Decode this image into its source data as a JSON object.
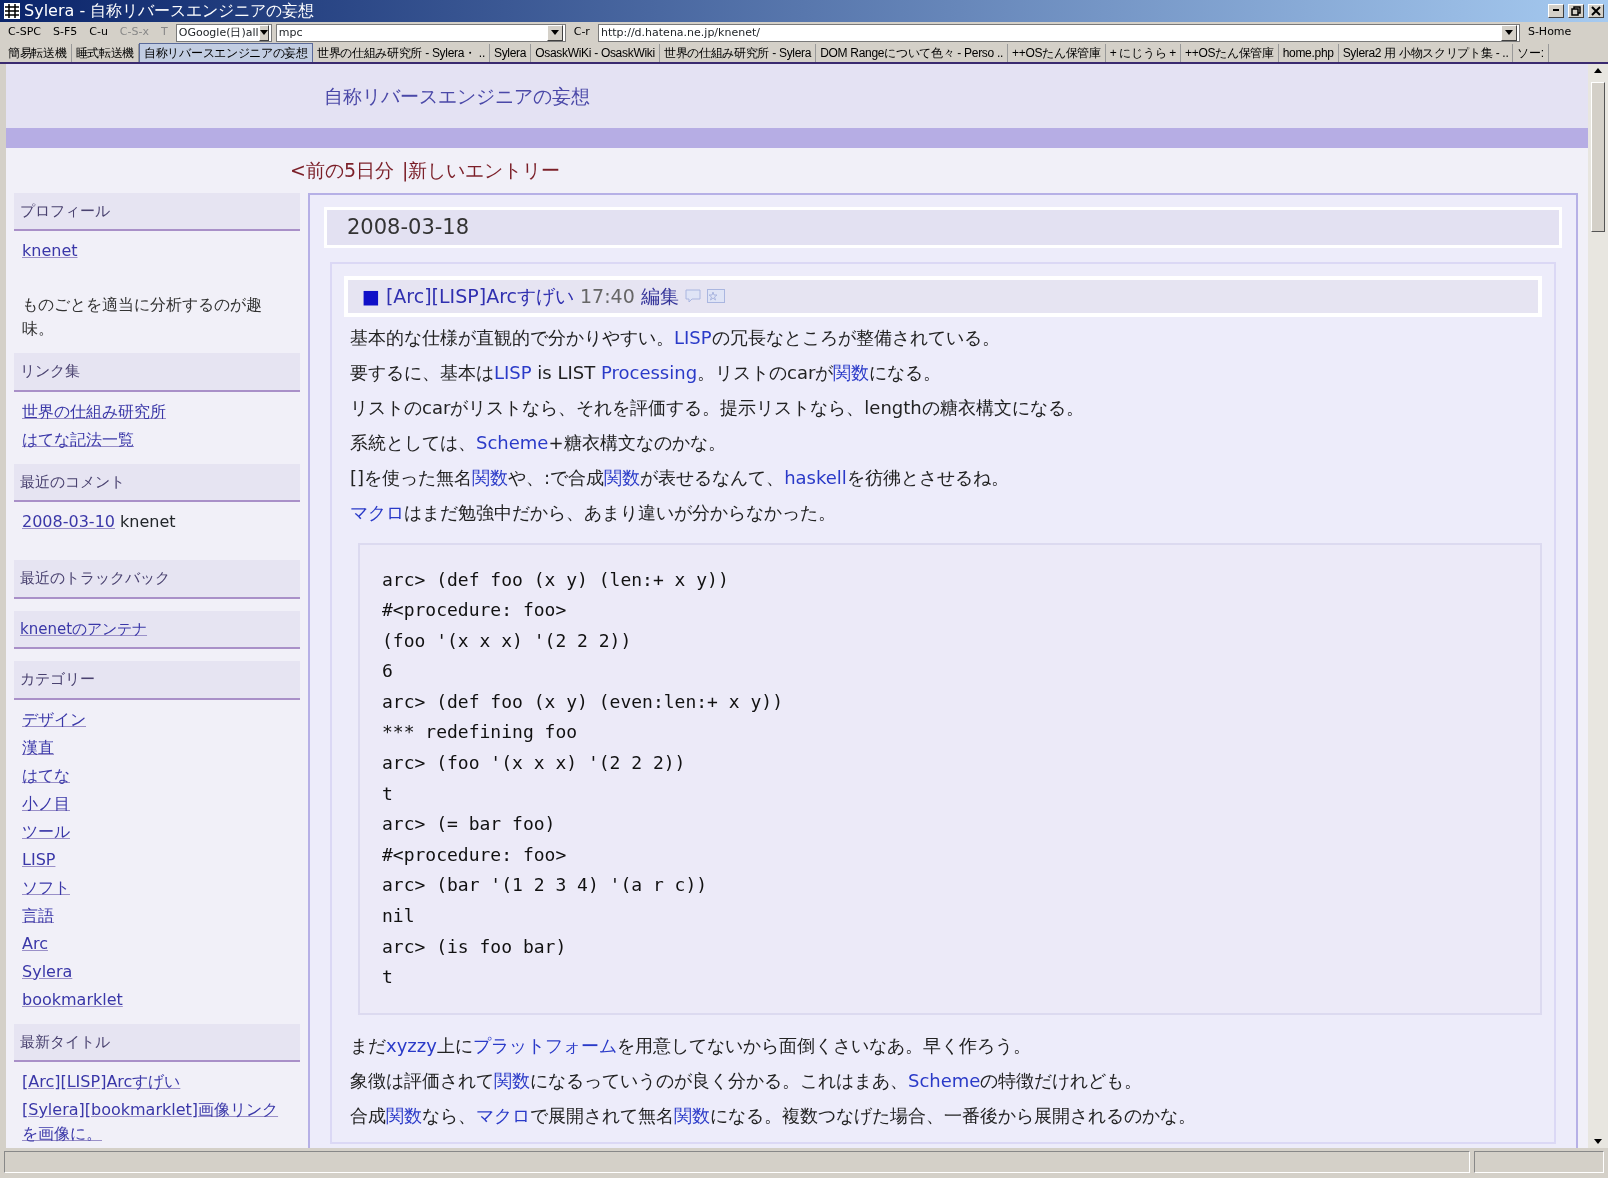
{
  "window": {
    "title": "Sylera - 自称リバースエンジニアの妄想"
  },
  "toolbar": {
    "keys": [
      {
        "label": "C-SPC",
        "disabled": false
      },
      {
        "label": "S-F5",
        "disabled": false
      },
      {
        "label": "C-u",
        "disabled": false
      },
      {
        "label": "C-S-x",
        "disabled": true
      },
      {
        "label": "T",
        "disabled": true
      }
    ],
    "engine": "OGoogle(日)all",
    "search_value": "mpc",
    "url_key": "C-r",
    "url": "http://d.hatena.ne.jp/knenet/",
    "home_key": "S-Home"
  },
  "bookmarks": [
    {
      "label": "簡易転送機",
      "selected": false
    },
    {
      "label": "睡式転送機",
      "selected": false
    },
    {
      "label": "自称リバースエンジニアの妄想",
      "selected": true
    },
    {
      "label": "世界の仕組み研究所 - Sylera・ ..",
      "selected": false
    },
    {
      "label": "Sylera",
      "selected": false
    },
    {
      "label": "OsaskWiKi - OsaskWiki",
      "selected": false
    },
    {
      "label": "世界の仕組み研究所 - Sylera",
      "selected": false
    },
    {
      "label": "DOM Rangeについて色々 - Perso ..",
      "selected": false
    },
    {
      "label": "++OSたん保管庫",
      "selected": false
    },
    {
      "label": "+ にじうら +",
      "selected": false
    },
    {
      "label": "++OSたん保管庫",
      "selected": false
    },
    {
      "label": "home.php",
      "selected": false
    },
    {
      "label": "Sylera2 用 小物スクリプト集 - ..",
      "selected": false
    },
    {
      "label": "ソー:",
      "selected": false
    }
  ],
  "blog": {
    "title": "自称リバースエンジニアの妄想",
    "nav": [
      {
        "text": "<前の5日分"
      },
      {
        "text": "|新しいエントリー"
      }
    ]
  },
  "sidebar": [
    {
      "kind": "plain",
      "heading": "プロフィール",
      "items": [
        {
          "kind": "link",
          "text": "knenet"
        }
      ],
      "note": "ものごとを適当に分析するのが趣味。"
    },
    {
      "kind": "plain",
      "heading": "リンク集",
      "items": [
        {
          "kind": "link",
          "text": "世界の仕組み研究所"
        },
        {
          "kind": "link",
          "text": "はてな記法一覧"
        }
      ]
    },
    {
      "kind": "plain",
      "heading": "最近のコメント",
      "items": [
        {
          "kind": "link",
          "text": "2008-03-10",
          "after": "knenet"
        }
      ]
    },
    {
      "kind": "plain",
      "heading": "最近のトラックバック"
    },
    {
      "kind": "link",
      "heading": "knenetのアンテナ"
    },
    {
      "kind": "plain",
      "heading": "カテゴリー",
      "items": [
        {
          "kind": "link",
          "text": "デザイン"
        },
        {
          "kind": "link",
          "text": "漢直"
        },
        {
          "kind": "link",
          "text": "はてな"
        },
        {
          "kind": "link",
          "text": "小ノ目"
        },
        {
          "kind": "link",
          "text": "ツール"
        },
        {
          "kind": "link",
          "text": "LISP"
        },
        {
          "kind": "link",
          "text": "ソフト"
        },
        {
          "kind": "link",
          "text": "言語"
        },
        {
          "kind": "link",
          "text": "Arc"
        },
        {
          "kind": "link",
          "text": "Sylera"
        },
        {
          "kind": "link",
          "text": "bookmarklet"
        }
      ]
    },
    {
      "kind": "plain",
      "heading": "最新タイトル",
      "items": [
        {
          "kind": "link",
          "text": "[Arc][LISP]Arcすげい"
        },
        {
          "kind": "link",
          "text": "[Sylera][bookmarklet]画像リンクを画像に。"
        }
      ]
    }
  ],
  "entry": {
    "date": "2008-03-18",
    "section_mark": "■",
    "section_title": "[Arc][LISP]Arcすげい",
    "time": "17:40",
    "edit": "編集",
    "before": [
      [
        {
          "kind": "text",
          "text": "基本的な仕様が直観的で分かりやすい。"
        },
        {
          "kind": "link",
          "text": "LISP"
        },
        {
          "kind": "text",
          "text": "の冗長なところが整備されている。"
        }
      ],
      [
        {
          "kind": "text",
          "text": "要するに、基本は"
        },
        {
          "kind": "link",
          "text": "LISP"
        },
        {
          "kind": "text",
          "text": " is LIST "
        },
        {
          "kind": "link",
          "text": "Processing"
        },
        {
          "kind": "text",
          "text": "。リストのcarが"
        },
        {
          "kind": "link",
          "text": "関数"
        },
        {
          "kind": "text",
          "text": "になる。"
        }
      ],
      [
        {
          "kind": "text",
          "text": "リストのcarがリストなら、それを評価する。提示リストなら、lengthの糖衣構文になる。"
        }
      ],
      [
        {
          "kind": "text",
          "text": "系統としては、"
        },
        {
          "kind": "link",
          "text": "Scheme"
        },
        {
          "kind": "text",
          "text": "+糖衣構文なのかな。"
        }
      ],
      [
        {
          "kind": "text",
          "text": "[]を使った無名"
        },
        {
          "kind": "link",
          "text": "関数"
        },
        {
          "kind": "text",
          "text": "や、:で合成"
        },
        {
          "kind": "link",
          "text": "関数"
        },
        {
          "kind": "text",
          "text": "が表せるなんて、"
        },
        {
          "kind": "link",
          "text": "haskell"
        },
        {
          "kind": "text",
          "text": "を彷彿とさせるね。"
        }
      ],
      [
        {
          "kind": "link",
          "text": "マクロ"
        },
        {
          "kind": "text",
          "text": "はまだ勉強中だから、あまり違いが分からなかった。"
        }
      ]
    ],
    "code": [
      "arc> (def foo (x y) (len:+ x y))",
      "#<procedure: foo>",
      "(foo '(x x x) '(2 2 2))",
      "6",
      "arc> (def foo (x y) (even:len:+ x y))",
      "*** redefining foo",
      "arc> (foo '(x x x) '(2 2 2))",
      "t",
      "arc> (= bar foo)",
      "#<procedure: foo>",
      "arc> (bar '(1 2 3 4) '(a r c))",
      "nil",
      "arc> (is foo bar)",
      "t"
    ],
    "after": [
      [
        {
          "kind": "text",
          "text": "まだ"
        },
        {
          "kind": "link",
          "text": "xyzzy"
        },
        {
          "kind": "text",
          "text": "上に"
        },
        {
          "kind": "link",
          "text": "プラットフォーム"
        },
        {
          "kind": "text",
          "text": "を用意してないから面倒くさいなあ。早く作ろう。"
        }
      ],
      [
        {
          "kind": "text",
          "text": "象徴は評価されて"
        },
        {
          "kind": "link",
          "text": "関数"
        },
        {
          "kind": "text",
          "text": "になるっていうのが良く分かる。これはまあ、"
        },
        {
          "kind": "link",
          "text": "Scheme"
        },
        {
          "kind": "text",
          "text": "の特徴だけれども。"
        }
      ],
      [
        {
          "kind": "text",
          "text": "合成"
        },
        {
          "kind": "link",
          "text": "関数"
        },
        {
          "kind": "text",
          "text": "なら、"
        },
        {
          "kind": "link",
          "text": "マクロ"
        },
        {
          "kind": "text",
          "text": "で展開されて無名"
        },
        {
          "kind": "link",
          "text": "関数"
        },
        {
          "kind": "text",
          "text": "になる。複数つなげた場合、一番後から展開されるのかな。"
        }
      ]
    ]
  }
}
